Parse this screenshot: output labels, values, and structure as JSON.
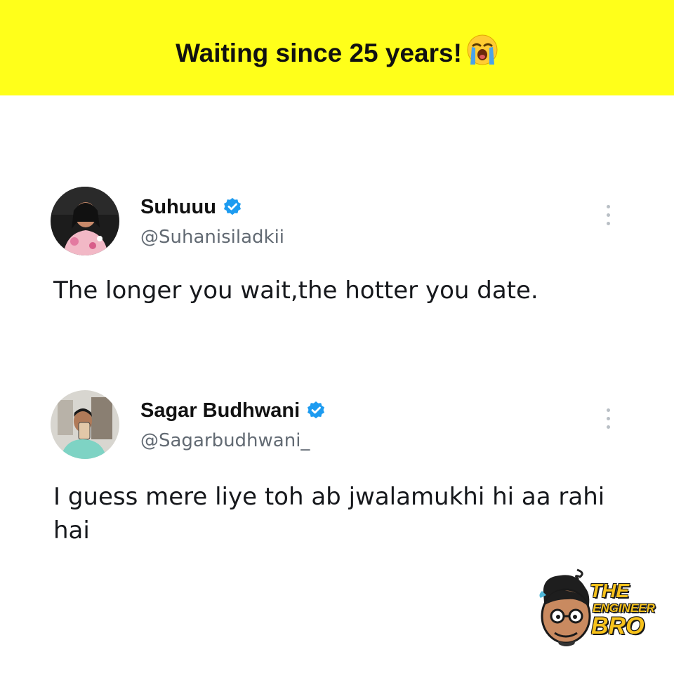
{
  "banner": {
    "title": "Waiting since 25 years!",
    "emoji_icon": "loudly-crying-face-icon",
    "background": "#ffff1a"
  },
  "tweets": [
    {
      "display_name": "Suhuuu",
      "handle": "@Suhanisiladkii",
      "verified": true,
      "text": "The longer you wait,the hotter you date."
    },
    {
      "display_name": "Sagar Budhwani",
      "handle": "@Sagarbudhwani_",
      "verified": true,
      "text": "I guess mere liye toh ab jwalamukhi hi aa rahi hai"
    }
  ],
  "logo": {
    "line1": "THE",
    "line2": "ENGINEER",
    "line3": "BRO"
  },
  "colors": {
    "verified": "#1d9bf0",
    "handle": "#626a73",
    "text": "#16181c"
  }
}
